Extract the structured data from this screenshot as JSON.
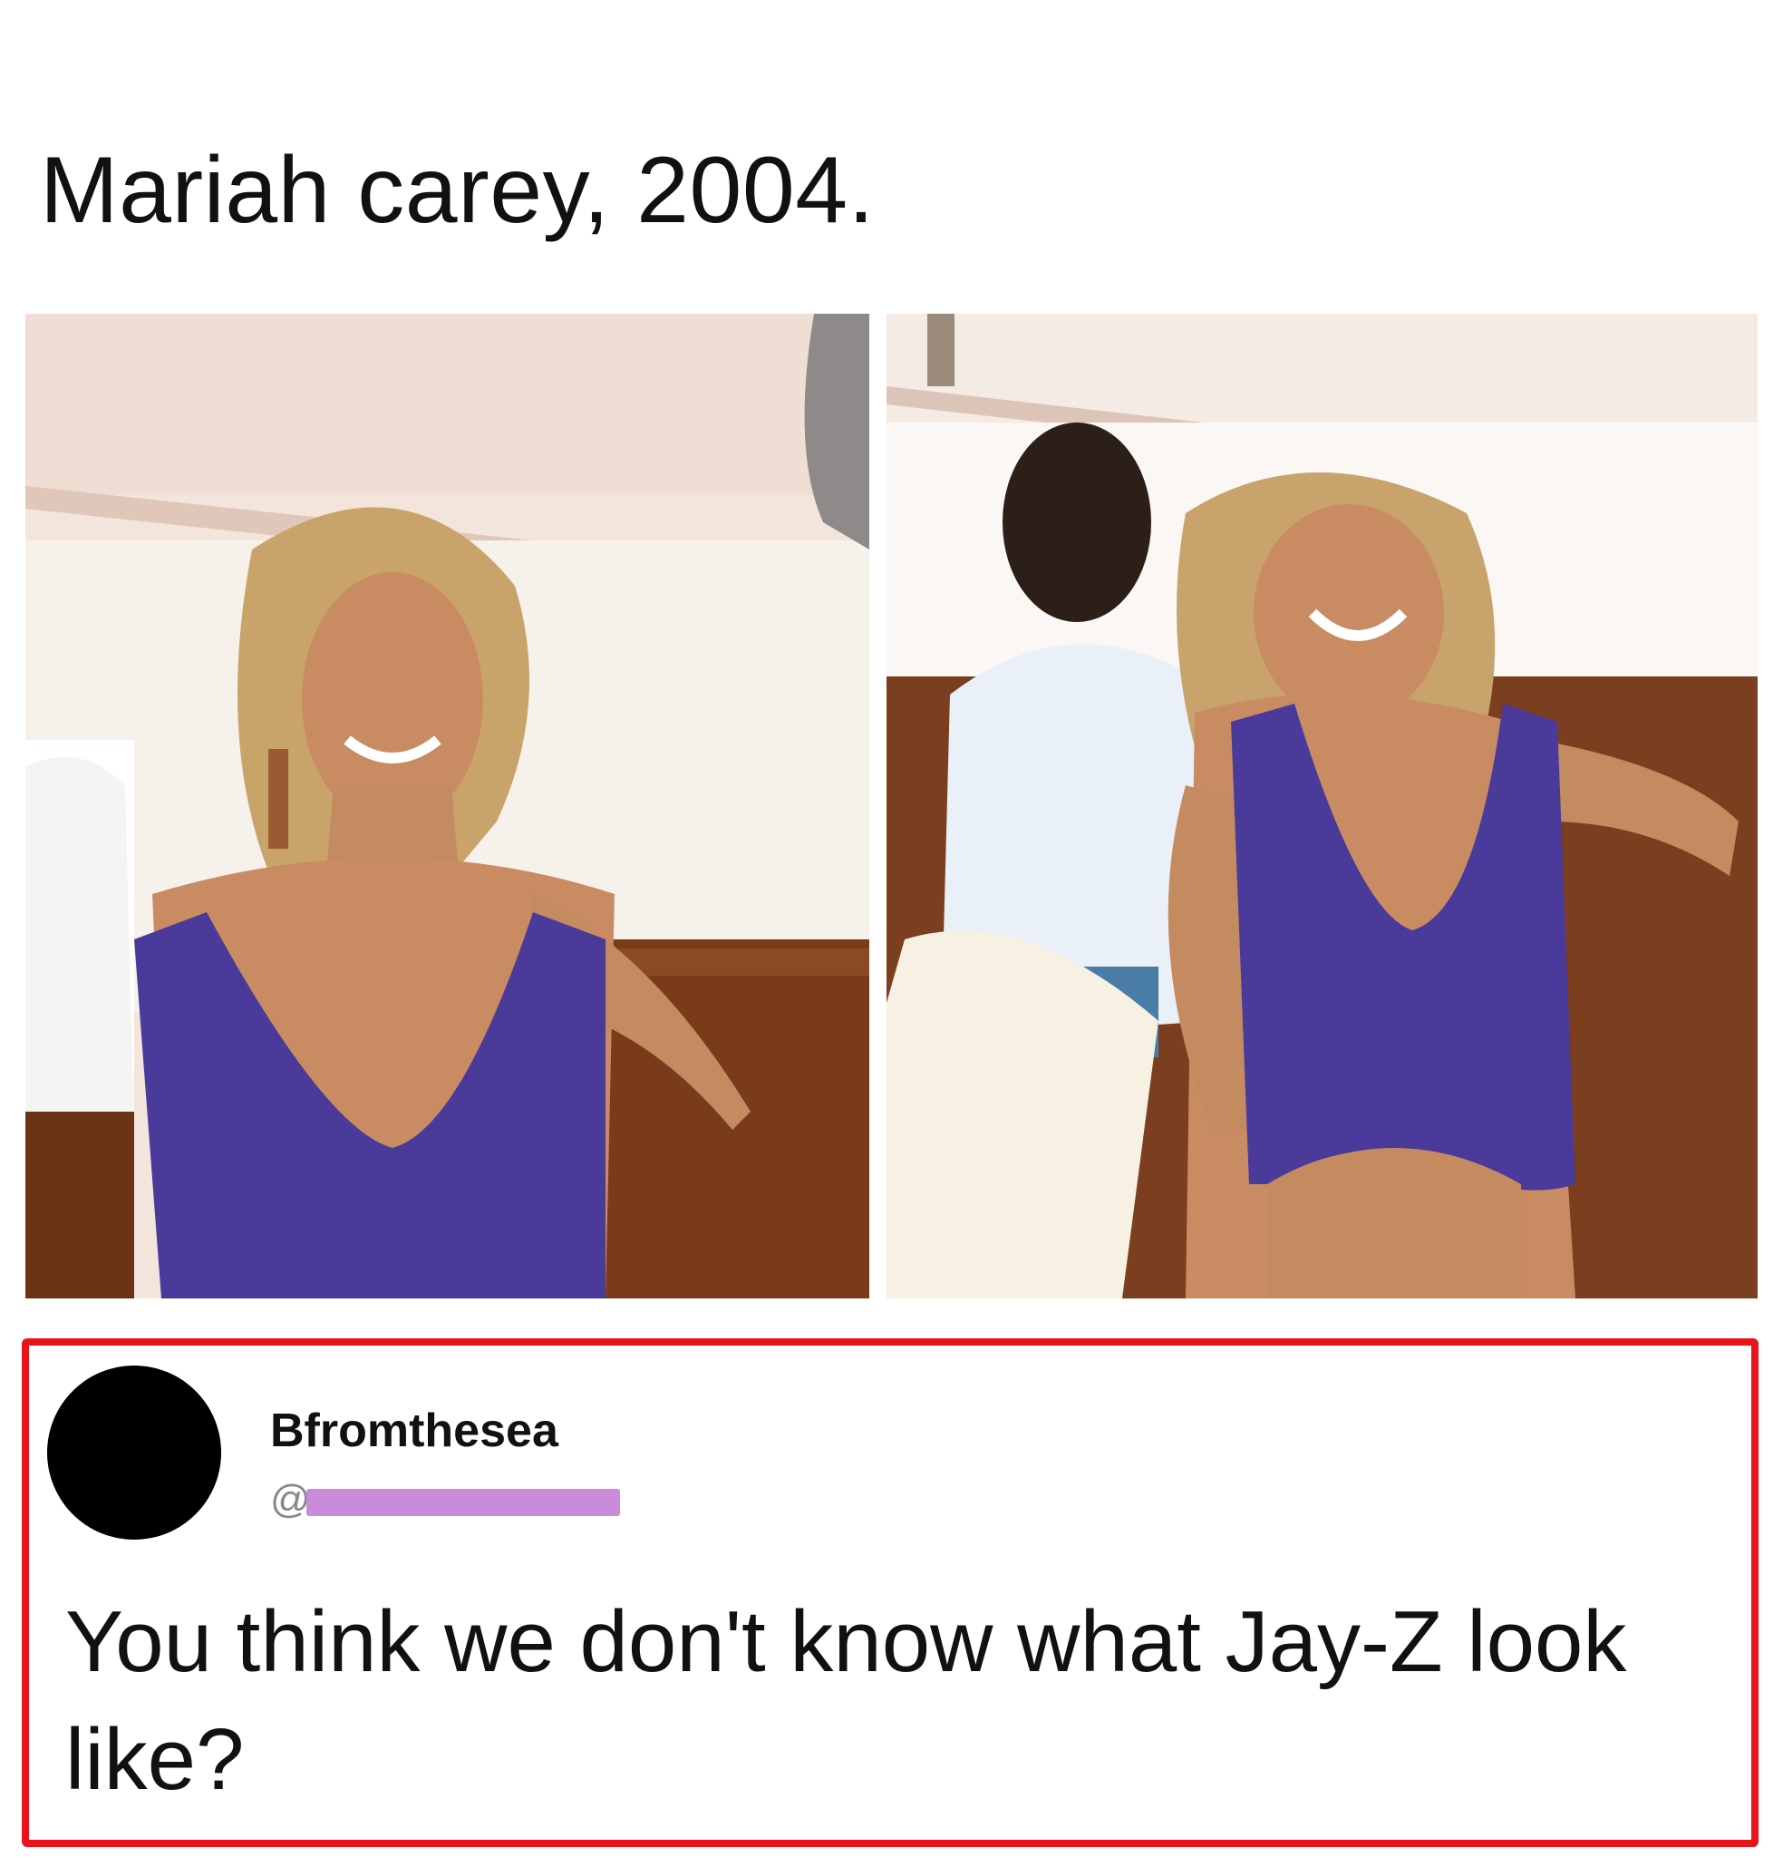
{
  "caption": "Mariah carey, 2004.",
  "photos": [
    {
      "name": "photo-left",
      "description_icon": "photo-icon"
    },
    {
      "name": "photo-right",
      "description_icon": "photo-icon"
    }
  ],
  "tweet": {
    "display_name": "Bfromthesea",
    "handle_prefix": "@",
    "handle_redaction_color": "#c98bda",
    "text": "You think we don't know what Jay-Z look like?"
  },
  "colors": {
    "frame_border": "#e8141a",
    "avatar": "#000000",
    "dress": "#4a3a9a"
  }
}
